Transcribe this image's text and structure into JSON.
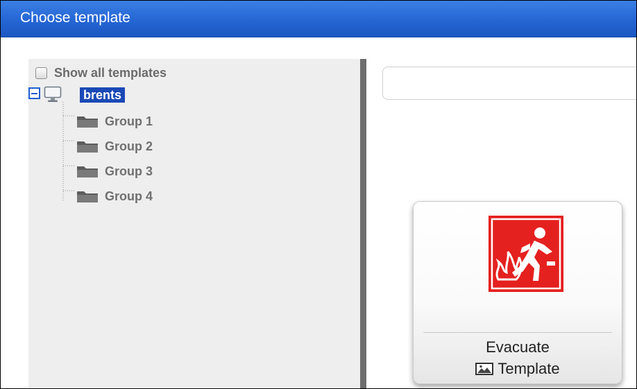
{
  "dialog": {
    "title": "Choose template"
  },
  "tree": {
    "show_all_label": "Show all templates",
    "show_all_checked": false,
    "root": {
      "label": "brents",
      "icon": "monitor-icon",
      "expanded": true
    },
    "groups": [
      {
        "label": "Group 1",
        "icon": "folder-icon"
      },
      {
        "label": "Group 2",
        "icon": "folder-icon"
      },
      {
        "label": "Group 3",
        "icon": "folder-icon"
      },
      {
        "label": "Group 4",
        "icon": "folder-icon"
      }
    ]
  },
  "search": {
    "value": "",
    "placeholder": ""
  },
  "templates": [
    {
      "name": "Evacuate",
      "type_label": "Template",
      "type_icon": "image-icon",
      "thumbnail": "evacuate-sign-icon",
      "thumbnail_caption": ""
    }
  ],
  "colors": {
    "titlebar": "#2566d4",
    "selection": "#1a49b6",
    "sign_red": "#e4211f"
  }
}
